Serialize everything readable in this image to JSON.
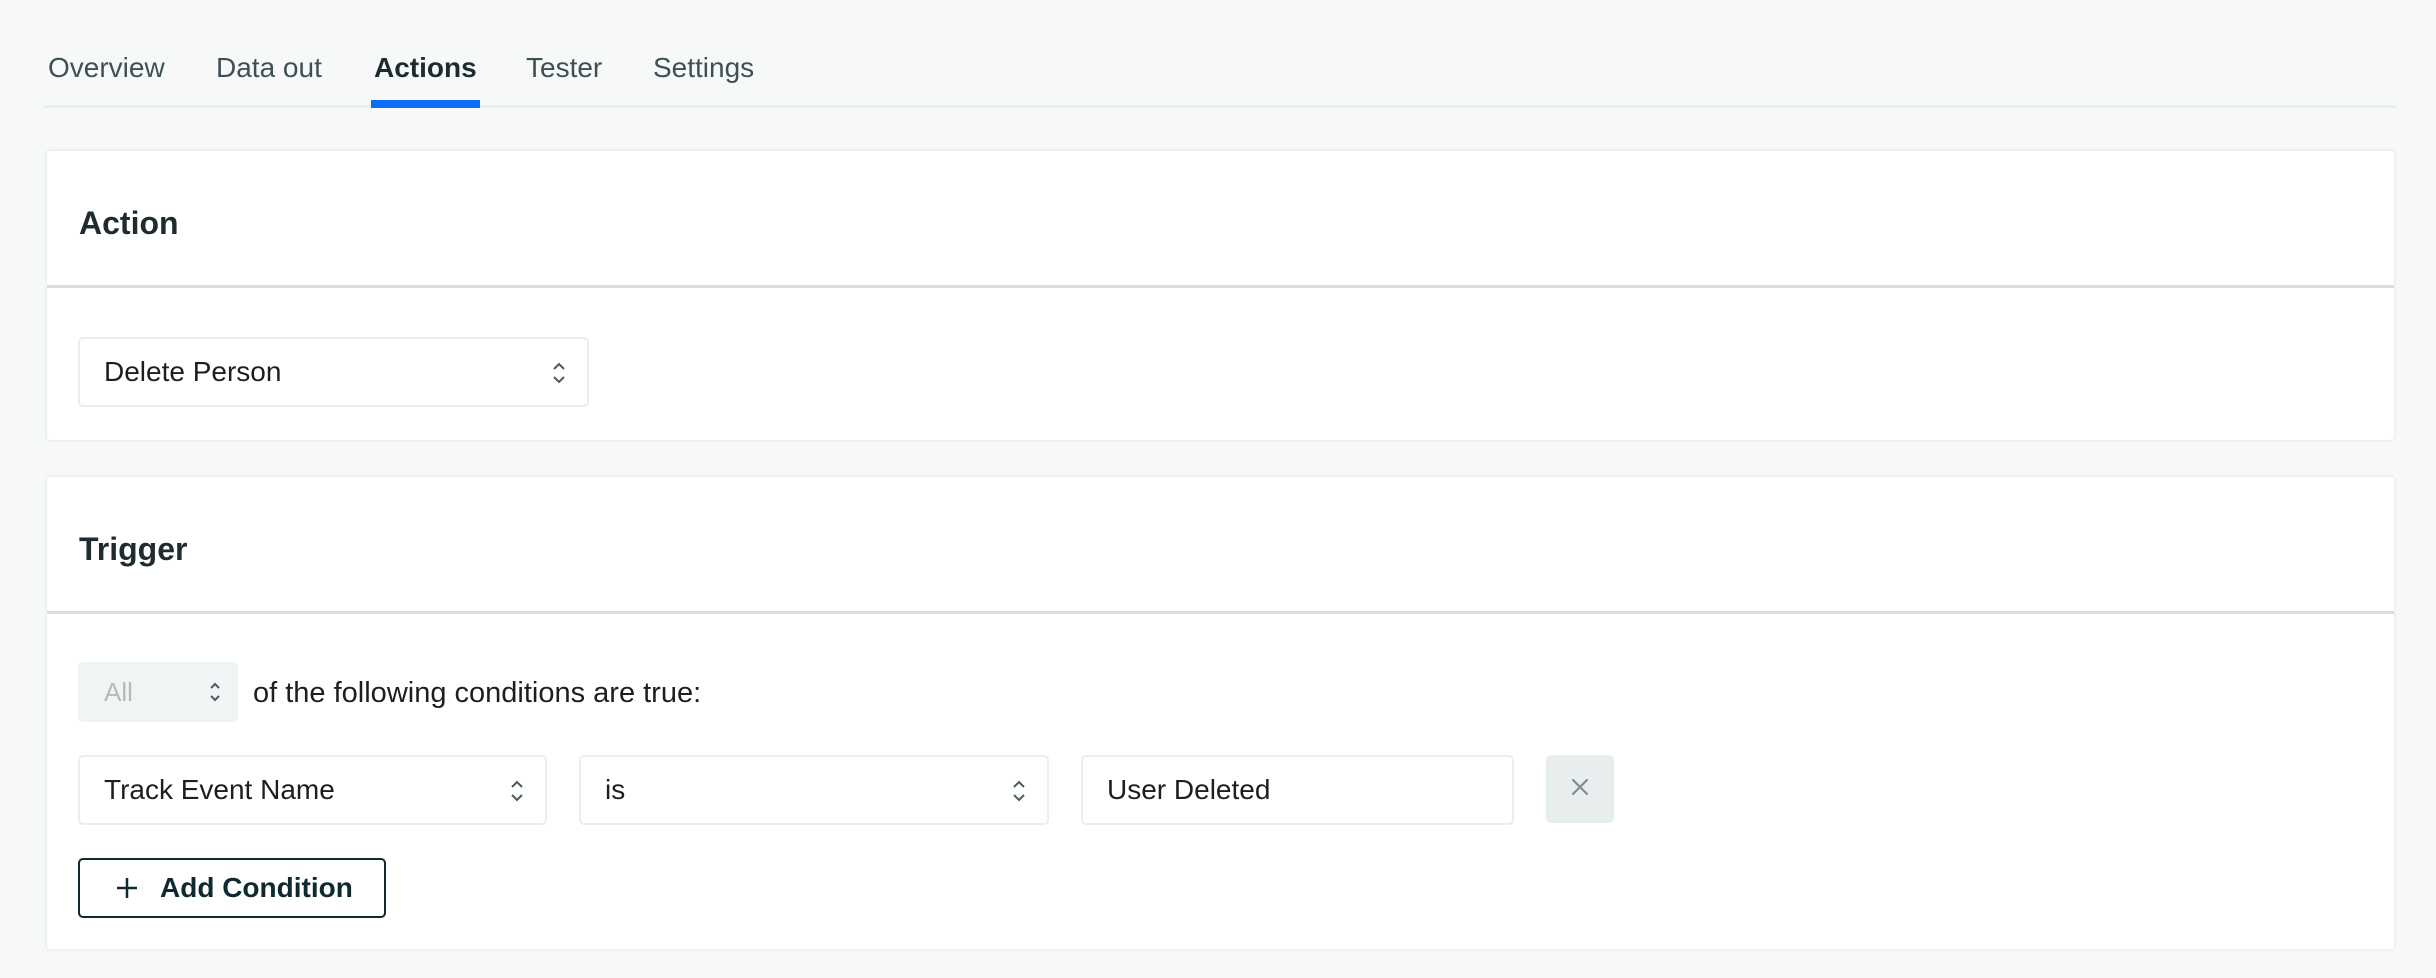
{
  "tabs": [
    {
      "label": "Overview",
      "active": false
    },
    {
      "label": "Data out",
      "active": false
    },
    {
      "label": "Actions",
      "active": true
    },
    {
      "label": "Tester",
      "active": false
    },
    {
      "label": "Settings",
      "active": false
    }
  ],
  "action_card": {
    "title": "Action",
    "action_select": {
      "value": "Delete Person",
      "icon": "chevron-up-down-icon"
    }
  },
  "trigger_card": {
    "title": "Trigger",
    "match_select": {
      "value": "All",
      "disabled": true,
      "icon": "chevron-up-down-icon"
    },
    "match_text": "of the following conditions are true:",
    "conditions": [
      {
        "field": "Track Event Name",
        "operator": "is",
        "value": "User Deleted",
        "remove_icon": "close-icon"
      }
    ],
    "add_condition_label": "Add Condition",
    "add_icon": "plus-icon"
  },
  "colors": {
    "accent": "#0a6cf0",
    "page_bg": "#f7f9f9",
    "card_bg": "#ffffff",
    "button_border": "#0e2a30",
    "disabled_bg": "#f0f4f4",
    "remove_bg": "#e8eded"
  }
}
